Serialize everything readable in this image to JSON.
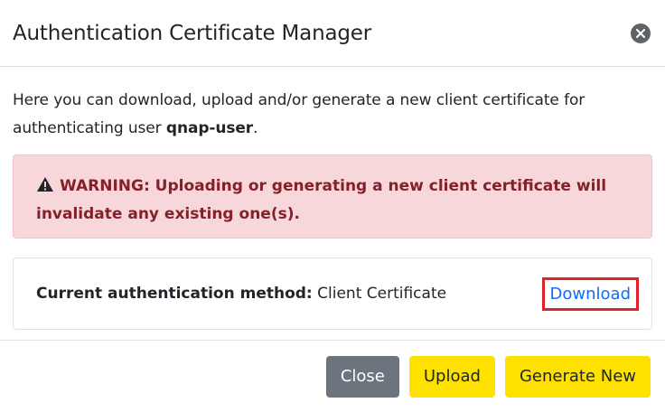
{
  "modal": {
    "title": "Authentication Certificate Manager"
  },
  "intro": {
    "text_before": "Here you can download, upload and/or generate a new client certificate for authenticating user ",
    "username": "qnap-user",
    "text_after": "."
  },
  "warning": {
    "icon": "warning-triangle-icon",
    "text": "WARNING: Uploading or generating a new client certificate will invalidate any existing one(s).",
    "color": "#842029",
    "background": "#f8d7da"
  },
  "method": {
    "label": "Current authentication method:",
    "value": "Client Certificate",
    "download_label": "Download",
    "highlight_color": "#e0202a"
  },
  "footer": {
    "close_label": "Close",
    "upload_label": "Upload",
    "generate_label": "Generate New"
  },
  "colors": {
    "accent_yellow": "#ffe100",
    "secondary_gray": "#6c757d",
    "link_blue": "#0d6efd"
  }
}
